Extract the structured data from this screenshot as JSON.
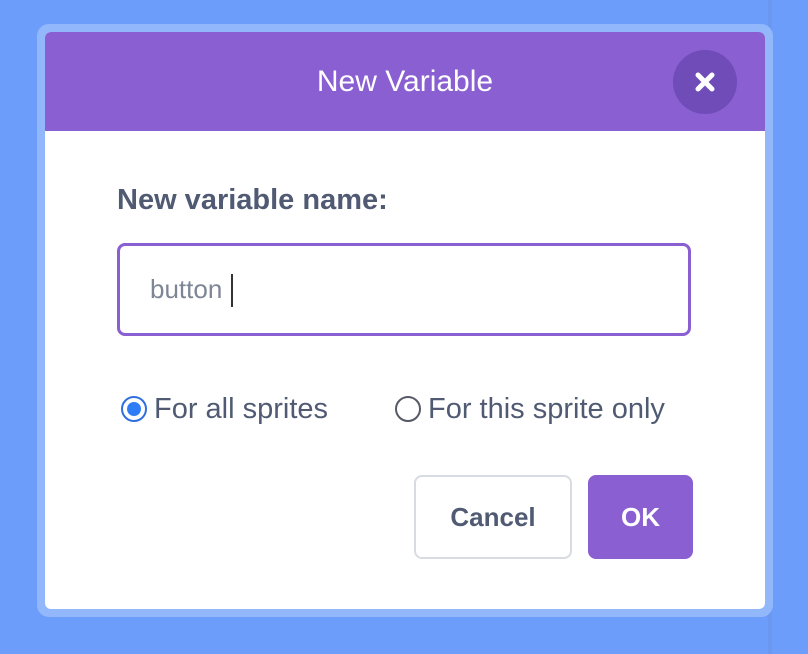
{
  "dialog": {
    "title": "New Variable",
    "close_icon": "close-icon",
    "field_label": "New variable name:",
    "name_input": {
      "value": "button",
      "placeholder": ""
    },
    "scope_options": [
      {
        "label": "For all sprites",
        "checked": true
      },
      {
        "label": "For this sprite only",
        "checked": false
      }
    ],
    "cancel_label": "Cancel",
    "ok_label": "OK"
  },
  "colors": {
    "backdrop": "#6c9dfa",
    "header": "#8a5fd1",
    "close_button": "#6f4cb8",
    "text": "#505b73",
    "radio_selected": "#2f7df6"
  }
}
